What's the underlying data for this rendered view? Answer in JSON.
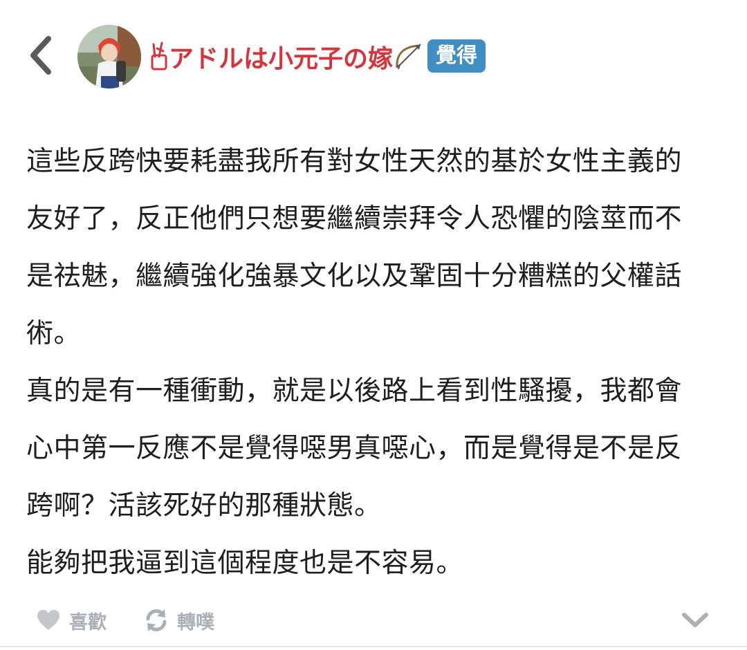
{
  "header": {
    "username_prefix": "",
    "username": "アドルは小元子の嫁",
    "username_suffix": "",
    "qualifier": "覺得"
  },
  "post": {
    "paragraphs": [
      "這些反跨快要耗盡我所有對女性天然的基於女性主義的友好了，反正他們只想要繼續崇拜令人恐懼的陰莖而不是祛魅，繼續強化強暴文化以及鞏固十分糟糕的父權話術。",
      "真的是有一種衝動，就是以後路上看到性騷擾，我都會心中第一反應不是覺得噁男真噁心，而是覺得是不是反跨啊？活該死好的那種狀態。",
      "能夠把我逼到這個程度也是不容易。"
    ]
  },
  "footer": {
    "like_label": "喜歡",
    "replurk_label": "轉噗"
  },
  "colors": {
    "username": "#d8323b",
    "qualifier_bg": "#3f8fc4",
    "icon_gray": "#aab0b6",
    "back_arrow": "#5a5a5a"
  },
  "icons": {
    "back": "chevron-left-icon",
    "like": "heart-icon",
    "replurk": "refresh-icon",
    "expand": "chevron-down-icon"
  }
}
